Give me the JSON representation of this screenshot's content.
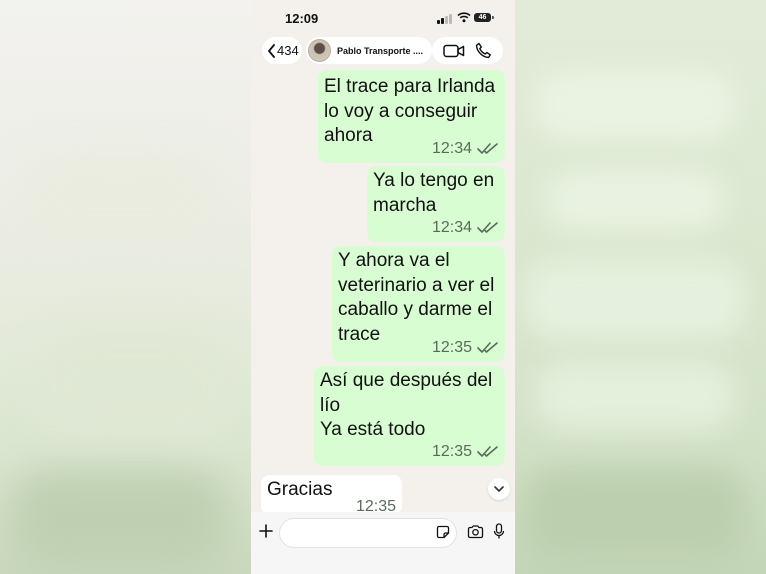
{
  "status_bar": {
    "time": "12:09",
    "battery": "46"
  },
  "header": {
    "back_count": "434",
    "contact_name": "Pablo Transporte ...."
  },
  "messages": [
    {
      "text": "El trace para Irlanda\nlo voy a conseguir\nahora",
      "time": "12:34",
      "direction": "outgoing",
      "status": "read"
    },
    {
      "text": "Ya lo tengo en\nmarcha",
      "time": "12:34",
      "direction": "outgoing",
      "status": "read"
    },
    {
      "text": "Y ahora va el\nveterinario a ver el\ncaballo y darme el\ntrace",
      "time": "12:35",
      "direction": "outgoing",
      "status": "read"
    },
    {
      "text": "Así que después del\nlío\nYa está todo",
      "time": "12:35",
      "direction": "outgoing",
      "status": "read"
    },
    {
      "text": "Gracias",
      "time": "12:35",
      "direction": "incoming"
    }
  ],
  "input": {
    "value": "",
    "placeholder": ""
  },
  "colors": {
    "outgoing_bubble": "#d9fdd3",
    "incoming_bubble": "#ffffff",
    "chat_background": "#f4f1ec",
    "read_ticks": "#5b6b5b"
  },
  "icons": {
    "back": "chevron-left-icon",
    "video": "video-camera-icon",
    "call": "phone-icon",
    "scroll": "chevron-down-icon",
    "attach": "plus-icon",
    "sticker": "sticker-icon",
    "camera": "camera-icon",
    "mic": "microphone-icon"
  }
}
